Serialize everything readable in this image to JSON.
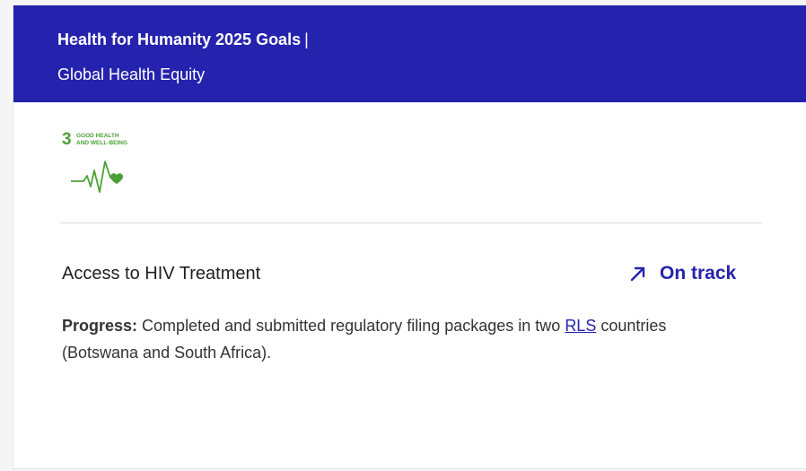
{
  "header": {
    "title": "Health for Humanity 2025 Goals",
    "separator": "|",
    "subtitle": "Global Health Equity"
  },
  "sdg_badge": {
    "number": "3",
    "label_line1": "GOOD HEALTH",
    "label_line2": "AND WELL-BEING",
    "icon": "heartbeat-heart-icon",
    "color": "#4c9f38"
  },
  "goal": {
    "title": "Access to HIV Treatment",
    "status": {
      "label": "On track",
      "icon": "arrow-up-right-icon",
      "color": "#2523ad"
    },
    "progress": {
      "label": "Progress:",
      "text_before": " Completed and submitted regulatory filing packages in two ",
      "link_text": "RLS",
      "text_after": " countries (Botswana and South Africa)."
    }
  },
  "colors": {
    "header_bg": "#2523ad",
    "accent": "#2523ad"
  }
}
